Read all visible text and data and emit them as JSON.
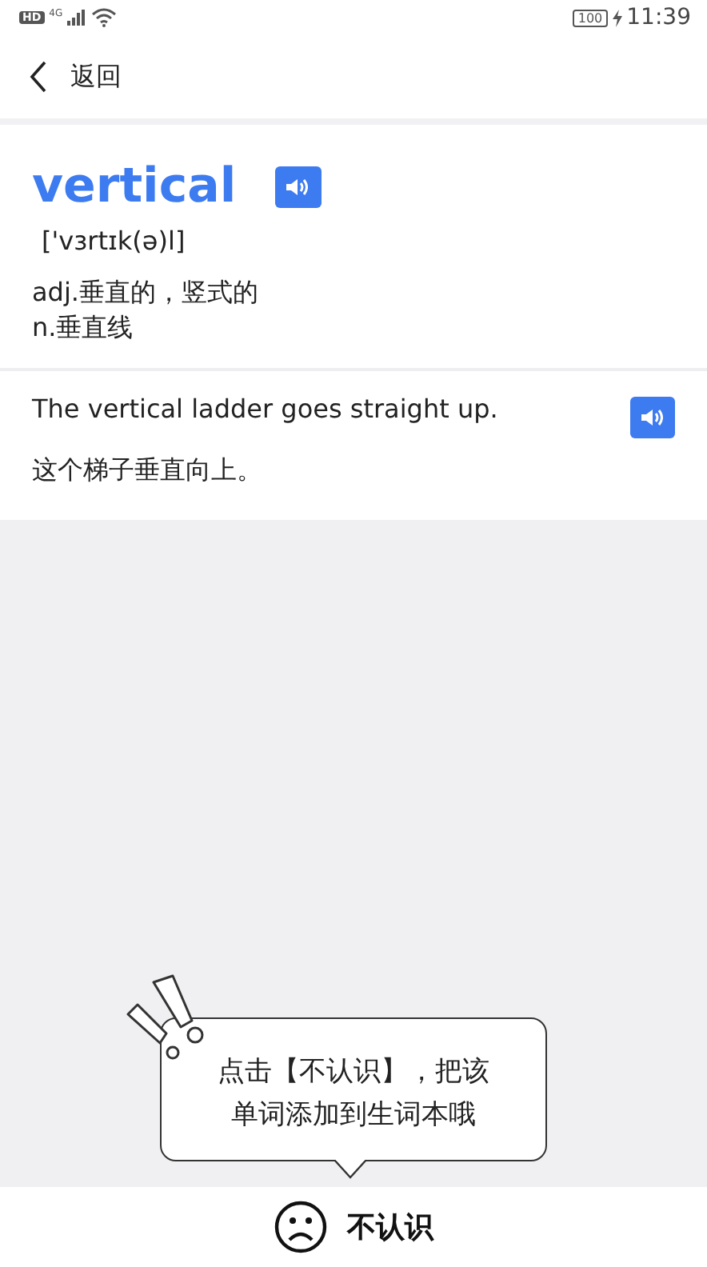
{
  "status_bar": {
    "hd": "HD",
    "network": "4G",
    "battery": "100",
    "time": "11:39"
  },
  "header": {
    "back": "返回"
  },
  "word": {
    "text": "vertical",
    "phonetic": "['vɜrtɪk(ə)l]",
    "meanings": [
      "adj.垂直的，竖式的",
      "n.垂直线"
    ]
  },
  "example": {
    "sentence": "The vertical ladder goes straight up.",
    "translation": "这个梯子垂直向上。"
  },
  "tip": {
    "lines": [
      "点击【不认识】，把该",
      "单词添加到生词本哦"
    ]
  },
  "bottom_button": {
    "label": "不认识"
  }
}
